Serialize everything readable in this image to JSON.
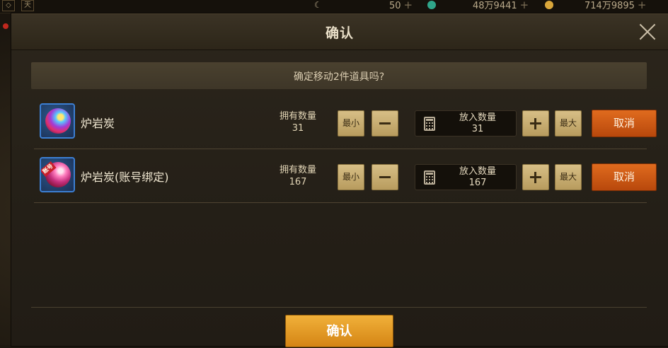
{
  "topbar": {
    "tab_icon": "天",
    "resources": [
      {
        "icon": "moon-icon",
        "value": "50",
        "plus": "+"
      },
      {
        "icon": "gem-icon",
        "color": "#2fa58a",
        "value": "48万9441",
        "plus": "+"
      },
      {
        "icon": "gold-coin-icon",
        "color": "#d9a63a",
        "value": "714万9895",
        "plus": "+"
      }
    ]
  },
  "dialog": {
    "title": "确认",
    "prompt": "确定移动2件道具吗?",
    "items": [
      {
        "name": "炉岩炭",
        "owned_label": "拥有数量",
        "owned_value": "31",
        "min_label": "最小",
        "max_label": "最大",
        "qty_label": "放入数量",
        "qty_value": "31",
        "cancel_label": "取消"
      },
      {
        "name": "炉岩炭(账号绑定)",
        "tag": "账号",
        "owned_label": "拥有数量",
        "owned_value": "167",
        "min_label": "最小",
        "max_label": "最大",
        "qty_label": "放入数量",
        "qty_value": "167",
        "cancel_label": "取消"
      }
    ],
    "confirm_label": "确认"
  },
  "colors": {
    "cancel": "#d45e16",
    "confirm": "#e49c24",
    "stepper": "#c8ad72",
    "icon_border": "#3c7fd3"
  }
}
